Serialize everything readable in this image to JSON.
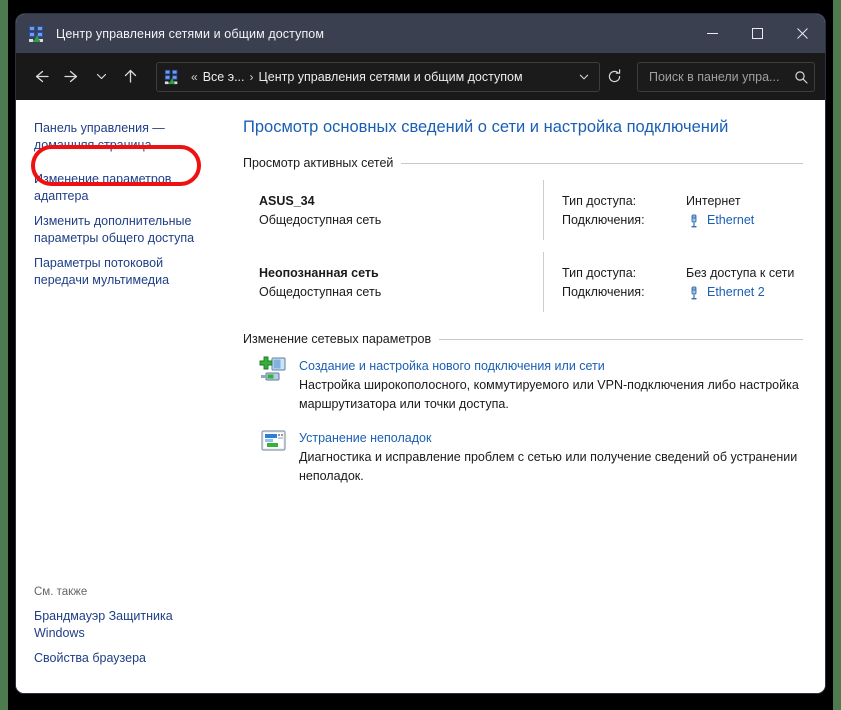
{
  "window": {
    "title": "Центр управления сетями и общим доступом",
    "app_icon": "network-sharing-center-icon",
    "controls": {
      "minimize": "minimize-icon",
      "maximize": "maximize-icon",
      "close": "close-icon"
    }
  },
  "toolbar": {
    "back": "back-arrow-icon",
    "forward": "forward-arrow-icon",
    "recent": "chevron-down-icon",
    "up": "up-arrow-icon",
    "address": {
      "icon": "network-sharing-center-icon",
      "overflow": "«",
      "crumb_1": "Все э...",
      "separator": "›",
      "crumb_2": "Центр управления сетями и общим доступом",
      "dropdown": "chevron-down-icon",
      "refresh": "refresh-icon"
    },
    "search": {
      "placeholder": "Поиск в панели упра...",
      "value": "",
      "icon": "search-icon"
    }
  },
  "sidebar": {
    "links": [
      "Панель управления — домашняя страница",
      "Изменение параметров адаптера",
      "Изменить дополнительные параметры общего доступа",
      "Параметры потоковой передачи мультимедиа"
    ],
    "see_also_label": "См. также",
    "see_also_links": [
      "Брандмауэр Защитника Windows",
      "Свойства браузера"
    ],
    "highlight": {
      "target": "Изменение параметров адаптера",
      "color": "#ee1111"
    }
  },
  "content": {
    "heading": "Просмотр основных сведений о сети и настройка подключений",
    "active_networks": {
      "section_title": "Просмотр активных сетей",
      "rows": [
        {
          "name": "ASUS_34",
          "profile": "Общедоступная сеть",
          "access_label": "Тип доступа:",
          "access_value": "Интернет",
          "connections_label": "Подключения:",
          "connection_name": "Ethernet",
          "connection_icon": "ethernet-plug-icon"
        },
        {
          "name": "Неопознанная сеть",
          "profile": "Общедоступная сеть",
          "access_label": "Тип доступа:",
          "access_value": "Без доступа к сети",
          "connections_label": "Подключения:",
          "connection_name": "Ethernet 2",
          "connection_icon": "ethernet-plug-icon"
        }
      ]
    },
    "change_settings": {
      "section_title": "Изменение сетевых параметров",
      "tasks": [
        {
          "icon": "new-connection-icon",
          "title": "Создание и настройка нового подключения или сети",
          "description": "Настройка широкополосного, коммутируемого или VPN-подключения либо настройка маршрутизатора или точки доступа."
        },
        {
          "icon": "troubleshoot-icon",
          "title": "Устранение неполадок",
          "description": "Диагностика и исправление проблем с сетью или получение сведений об устранении неполадок."
        }
      ]
    }
  },
  "colors": {
    "titlebar": "#3b4050",
    "toolbar": "#191919",
    "link": "#1a5fb4",
    "sidebar_link": "#1f3f86",
    "highlight": "#ee1111",
    "edge_accent": "#4e7a50"
  }
}
